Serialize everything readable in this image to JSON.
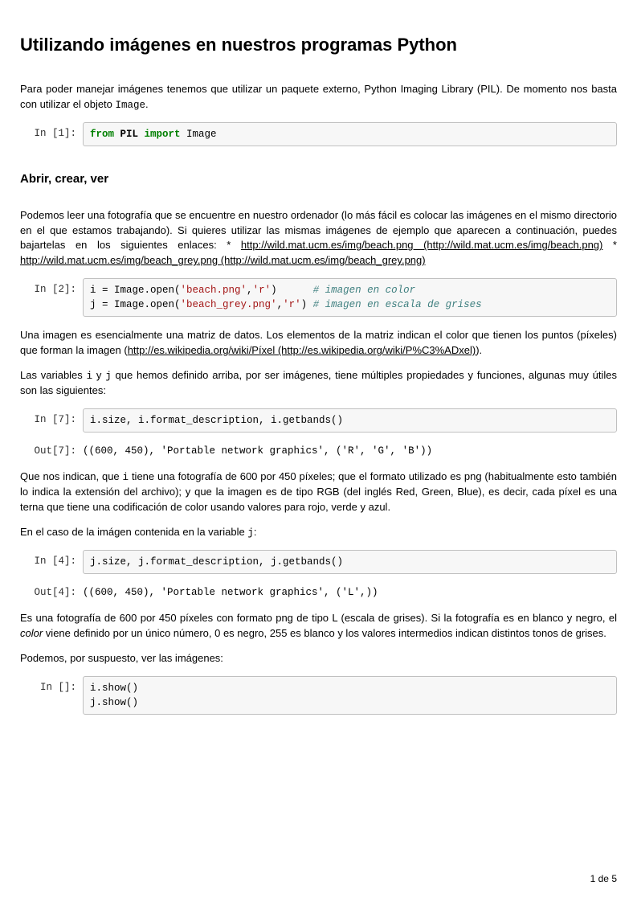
{
  "title": "Utilizando imágenes en nuestros programas Python",
  "p1_pre": "Para poder manejar imágenes tenemos que utilizar un paquete externo, Python Imaging Library (PIL). De momento nos basta con utilizar el objeto ",
  "p1_code": "Image",
  "p1_post": ".",
  "cell1": {
    "prompt": "In [1]:",
    "kw1": "from",
    "mod": " PIL ",
    "kw2": "import",
    "rest": " Image"
  },
  "h2a": "Abrir, crear, ver",
  "p2_pre": "Podemos leer una fotografía que se encuentre en nuestro ordenador (lo más fácil es colocar las imágenes en el mismo directorio en el que estamos trabajando). Si quieres utilizar las mismas imágenes de ejemplo que aparecen a continuación, puedes bajartelas en los siguientes enlaces: * ",
  "p2_link1": "http://wild.mat.ucm.es/img/beach.png (http://wild.mat.ucm.es/img/beach.png)",
  "p2_mid": " * ",
  "p2_link2": "http://wild.mat.ucm.es/img/beach_grey.png (http://wild.mat.ucm.es/img/beach_grey.png)",
  "cell2": {
    "prompt": "In [2]:",
    "l1a": "i = Image.open(",
    "l1s1": "'beach.png'",
    "l1b": ",",
    "l1s2": "'r'",
    "l1c": ")      ",
    "l1com": "# imagen en color",
    "l2a": "j = Image.open(",
    "l2s1": "'beach_grey.png'",
    "l2b": ",",
    "l2s2": "'r'",
    "l2c": ") ",
    "l2com": "# imagen en escala de grises"
  },
  "p3_pre": "Una imagen es esencialmente una matriz de datos. Los elementos de la matriz indican el color que tienen los puntos (píxeles) que forman la imagen (",
  "p3_link": "http://es.wikipedia.org/wiki/Píxel (http://es.wikipedia.org/wiki/P%C3%ADxel)",
  "p3_post": ").",
  "p4_pre": "Las variables ",
  "p4_c1": "i",
  "p4_mid1": " y ",
  "p4_c2": "j",
  "p4_post": " que hemos definido arriba, por ser imágenes, tiene múltiples propiedades y funciones, algunas muy útiles son las siguientes:",
  "cell7": {
    "prompt": "In [7]:",
    "code": "i.size, i.format_description, i.getbands()"
  },
  "out7": {
    "prompt": "Out[7]:",
    "text": "((600, 450), 'Portable network graphics', ('R', 'G', 'B'))"
  },
  "p5_pre": "Que nos indican, que ",
  "p5_c1": "i",
  "p5_post": " tiene una fotografía de 600 por 450 píxeles; que el formato utilizado es png (habitualmente esto también lo indica la extensión del archivo); y que la imagen es de tipo RGB (del inglés Red, Green, Blue), es decir, cada píxel es una terna que tiene una codificación de color usando valores para rojo, verde y azul.",
  "p6_pre": "En el caso de la imágen contenida en la variable ",
  "p6_c1": "j",
  "p6_post": ":",
  "cell4": {
    "prompt": "In [4]:",
    "code": "j.size, j.format_description, j.getbands()"
  },
  "out4": {
    "prompt": "Out[4]:",
    "text": "((600, 450), 'Portable network graphics', ('L',))"
  },
  "p7_pre": "Es una fotografía de 600 por 450 píxeles con formato png de tipo L (escala de grises). Si la fotografía es en blanco y negro, el ",
  "p7_em": "color",
  "p7_post": " viene definido por un único número, 0 es negro, 255 es blanco y los valores intermedios indican distintos tonos de grises.",
  "p8": "Podemos, por suspuesto, ver las imágenes:",
  "cell_blank": {
    "prompt": "In []:",
    "code": "i.show()\nj.show()"
  },
  "pagenum": "1 de 5"
}
